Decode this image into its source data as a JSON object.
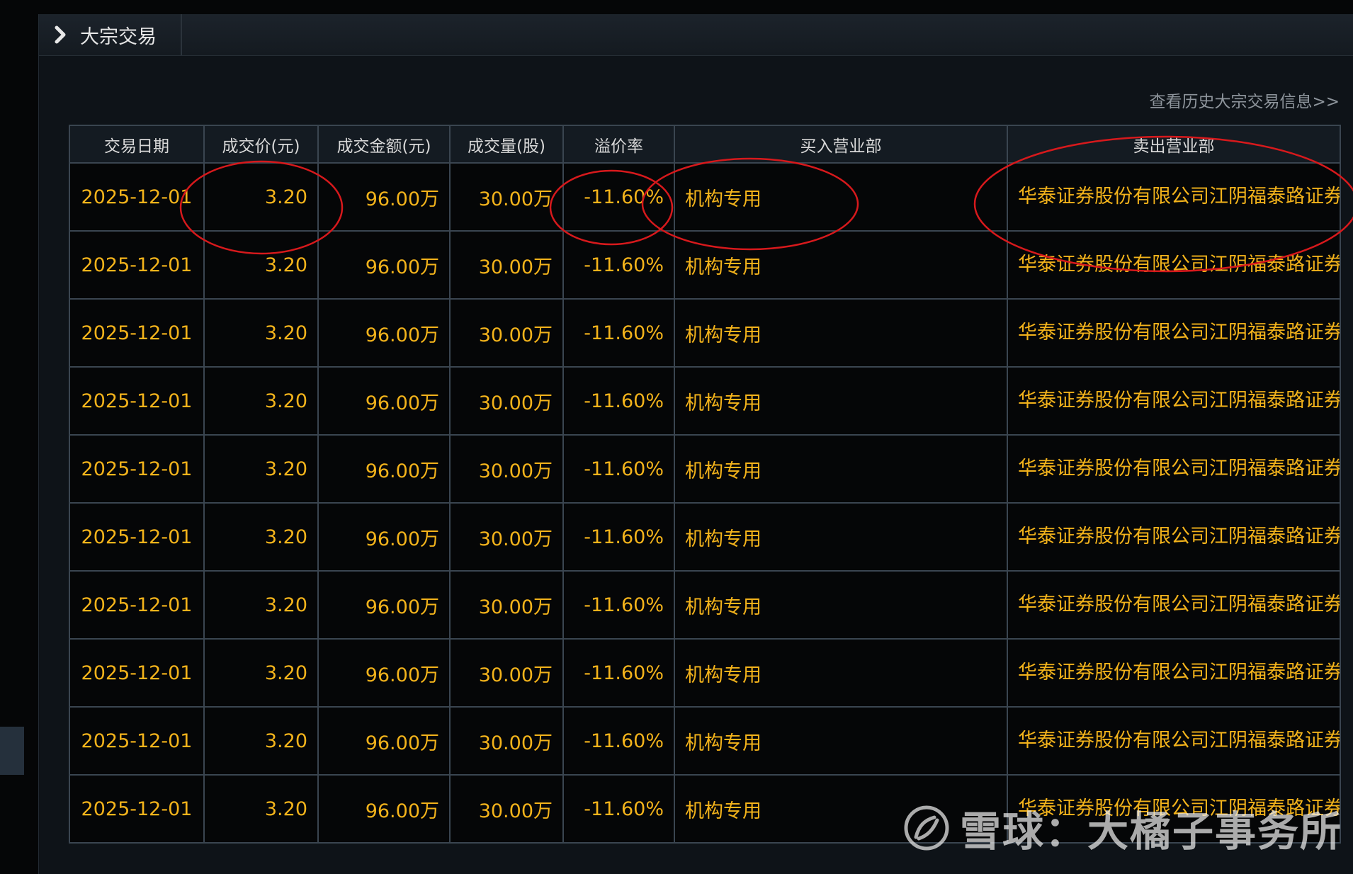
{
  "panel": {
    "title": "大宗交易",
    "history_link": "查看历史大宗交易信息>>"
  },
  "table": {
    "columns": [
      "交易日期",
      "成交价(元)",
      "成交金额(元)",
      "成交量(股)",
      "溢价率",
      "买入营业部",
      "卖出营业部"
    ],
    "rows": [
      {
        "date": "2025-12-01",
        "price": "3.20",
        "amount": "96.00万",
        "volume": "30.00万",
        "premium": "-11.60%",
        "buyer": "机构专用",
        "seller": "华泰证券股份有限公司江阴福泰路证券营业部"
      },
      {
        "date": "2025-12-01",
        "price": "3.20",
        "amount": "96.00万",
        "volume": "30.00万",
        "premium": "-11.60%",
        "buyer": "机构专用",
        "seller": "华泰证券股份有限公司江阴福泰路证券营业部"
      },
      {
        "date": "2025-12-01",
        "price": "3.20",
        "amount": "96.00万",
        "volume": "30.00万",
        "premium": "-11.60%",
        "buyer": "机构专用",
        "seller": "华泰证券股份有限公司江阴福泰路证券营业部"
      },
      {
        "date": "2025-12-01",
        "price": "3.20",
        "amount": "96.00万",
        "volume": "30.00万",
        "premium": "-11.60%",
        "buyer": "机构专用",
        "seller": "华泰证券股份有限公司江阴福泰路证券营业部"
      },
      {
        "date": "2025-12-01",
        "price": "3.20",
        "amount": "96.00万",
        "volume": "30.00万",
        "premium": "-11.60%",
        "buyer": "机构专用",
        "seller": "华泰证券股份有限公司江阴福泰路证券营业部"
      },
      {
        "date": "2025-12-01",
        "price": "3.20",
        "amount": "96.00万",
        "volume": "30.00万",
        "premium": "-11.60%",
        "buyer": "机构专用",
        "seller": "华泰证券股份有限公司江阴福泰路证券营业部"
      },
      {
        "date": "2025-12-01",
        "price": "3.20",
        "amount": "96.00万",
        "volume": "30.00万",
        "premium": "-11.60%",
        "buyer": "机构专用",
        "seller": "华泰证券股份有限公司江阴福泰路证券营业部"
      },
      {
        "date": "2025-12-01",
        "price": "3.20",
        "amount": "96.00万",
        "volume": "30.00万",
        "premium": "-11.60%",
        "buyer": "机构专用",
        "seller": "华泰证券股份有限公司江阴福泰路证券营业部"
      },
      {
        "date": "2025-12-01",
        "price": "3.20",
        "amount": "96.00万",
        "volume": "30.00万",
        "premium": "-11.60%",
        "buyer": "机构专用",
        "seller": "华泰证券股份有限公司江阴福泰路证券营业部"
      },
      {
        "date": "2025-12-01",
        "price": "3.20",
        "amount": "96.00万",
        "volume": "30.00万",
        "premium": "-11.60%",
        "buyer": "机构专用",
        "seller": "华泰证券股份有限公司江阴福泰路证券营业部"
      }
    ]
  },
  "watermark": {
    "text": "雪球：大橘子事务所",
    "icon": "snowball-logo-icon"
  },
  "colors": {
    "value_text": "#f3b31b",
    "annotation": "#d7191c",
    "grid": "#3a4550"
  }
}
